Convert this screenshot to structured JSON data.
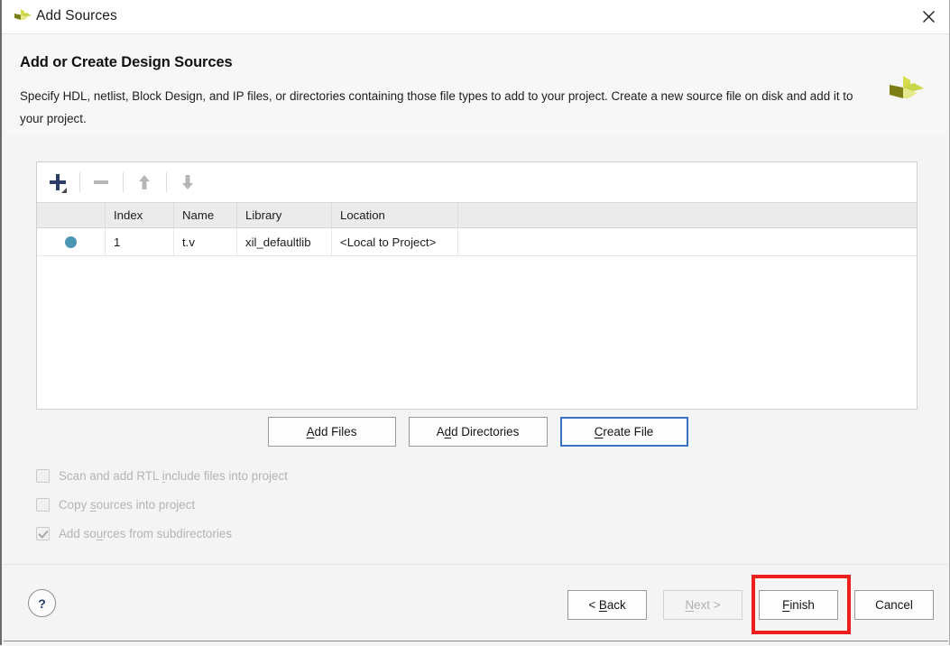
{
  "window": {
    "title": "Add Sources",
    "logo_icon": "vivado-logo-icon",
    "close_icon": "close-icon"
  },
  "header": {
    "title": "Add or Create Design Sources",
    "description": "Specify HDL, netlist, Block Design, and IP files, or directories containing those file types to add to your project. Create a new source file on disk and add it to your project.",
    "logo_icon": "vivado-logo-icon"
  },
  "toolbar": {
    "add_icon": "plus-icon",
    "add_dropdown_icon": "caret-down-icon",
    "remove_icon": "minus-icon",
    "move_up_icon": "arrow-up-icon",
    "move_down_icon": "arrow-down-icon"
  },
  "table": {
    "columns": [
      "",
      "Index",
      "Name",
      "Library",
      "Location"
    ],
    "rows": [
      {
        "status_icon": "status-dot-icon",
        "index": "1",
        "name": "t.v",
        "library": "xil_defaultlib",
        "location": "<Local to Project>"
      }
    ],
    "status_dot_color": "#4a96b3"
  },
  "actions": {
    "add_files": {
      "pre": "A",
      "mnemonic": "",
      "label": "Add Files"
    },
    "add_directories": {
      "label": "Add Directories"
    },
    "create_file": {
      "label": "Create File"
    }
  },
  "options": [
    {
      "label": "Scan and add RTL include files into project",
      "checked": false,
      "enabled": false
    },
    {
      "label": "Copy sources into project",
      "checked": false,
      "enabled": false
    },
    {
      "label": "Add sources from subdirectories",
      "checked": true,
      "enabled": false
    }
  ],
  "footer": {
    "help_label": "?",
    "back_label": "< Back",
    "next_label": "Next >",
    "finish_label": "Finish",
    "cancel_label": "Cancel",
    "next_enabled": false,
    "highlight_color": "#f01d1d"
  }
}
